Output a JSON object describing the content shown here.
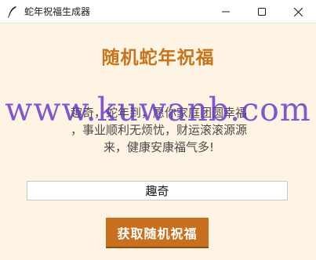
{
  "window": {
    "title": "蛇年祝福生成器",
    "icon": "feather-pen-icon",
    "controls": [
      "minimize-icon",
      "maximize-icon",
      "close-icon"
    ]
  },
  "main": {
    "heading": "随机蛇年祝福",
    "blessing_line1": "趣奇，蛇年到，愿你家庭团圆幸福",
    "blessing_line2": "，事业顺利无烦忧，财运滚滚源源",
    "blessing_line3": "来，健康安康福气多!",
    "name_input_value": "趣奇",
    "generate_button_label": "获取随机祝福"
  },
  "watermark": "www.kuwanb.com",
  "colors": {
    "background": "#fdf4e3",
    "heading": "#c8741c",
    "button": "#c9701e",
    "watermark": "#6633cc"
  }
}
